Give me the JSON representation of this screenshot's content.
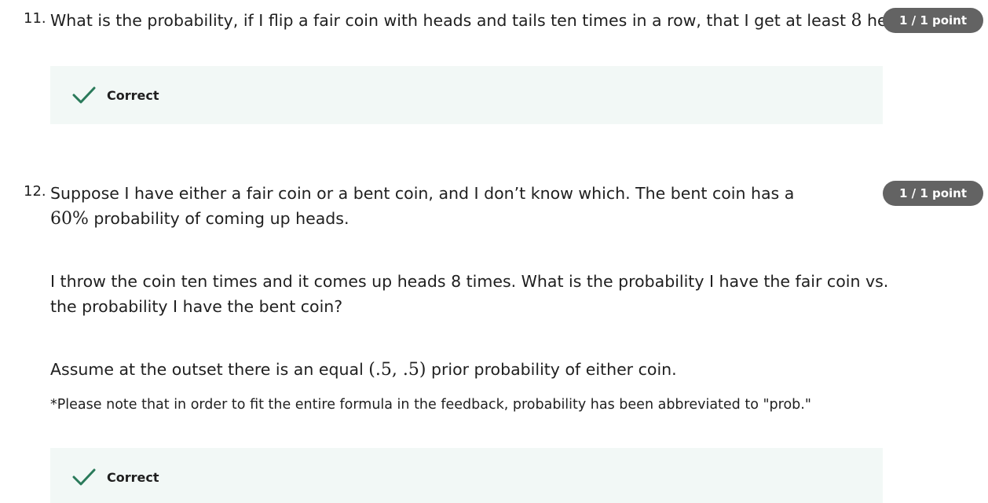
{
  "questions": [
    {
      "number": "11.",
      "text_before": "What is the probability, if I flip a fair coin with heads and tails ten times in a row, that I get at least ",
      "math_inline": "8",
      "text_after": " heads?",
      "points": "1 / 1 point",
      "feedback": {
        "label": "Correct",
        "icon": "check-icon"
      }
    },
    {
      "number": "12.",
      "para1_before": "Suppose I have either a fair coin or a bent coin, and I don’t know which. The bent coin has a ",
      "para1_math": "60%",
      "para1_after": " probability of coming up heads.",
      "para2": "I throw the coin ten times and it comes up heads 8 times. What is the probability I have the fair coin vs. the probability I have the bent coin?",
      "para3_before": "Assume at the outset there is an equal ",
      "para3_math": "(.5, .5)",
      "para3_after": " prior probability of either coin.",
      "note": "*Please note that in order to fit the entire formula in the feedback, probability has been abbreviated to \"prob.\"",
      "points": "1 / 1 point",
      "feedback": {
        "label": "Correct",
        "icon": "check-icon"
      }
    }
  ],
  "colors": {
    "badge_bg": "#636363",
    "feedback_bg": "#f2f8f6",
    "check_green": "#2a7a5a"
  }
}
